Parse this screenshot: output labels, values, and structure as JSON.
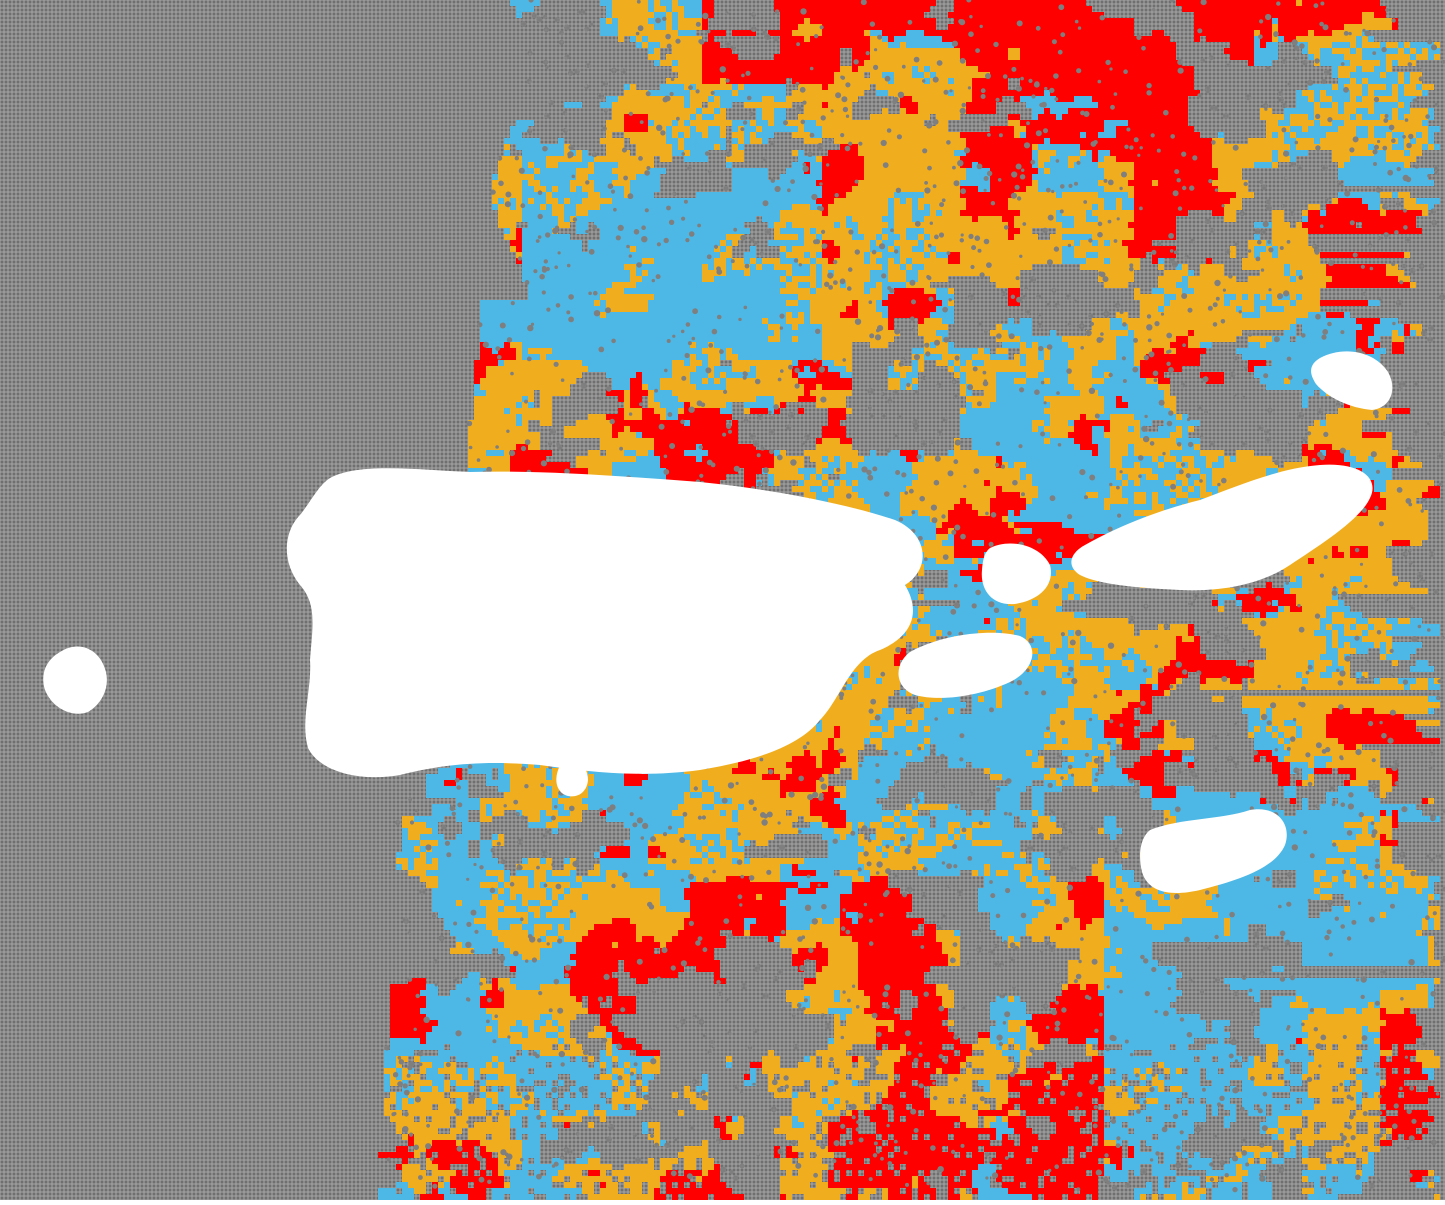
{
  "map": {
    "kind": "gridded classification raster",
    "labels_visible": false,
    "palette": {
      "background": "#ffffff",
      "no_data_cell": "#7f7f7f",
      "class_light_blue": "#4db8e6",
      "class_orange": "#f0ae1e",
      "class_red": "#ff0000",
      "land_mask": "#ffffff"
    },
    "classes": [
      {
        "id": "gray",
        "color": "#7f7f7f"
      },
      {
        "id": "blue",
        "color": "#4db8e6"
      },
      {
        "id": "orange",
        "color": "#f0ae1e"
      },
      {
        "id": "red",
        "color": "#ff0000"
      }
    ],
    "landmasses": [
      {
        "id": "main-island"
      },
      {
        "id": "small-west-island"
      },
      {
        "id": "south-islet"
      },
      {
        "id": "mid-island"
      },
      {
        "id": "small-center-island"
      },
      {
        "id": "east-long-island"
      },
      {
        "id": "northeast-island"
      },
      {
        "id": "southeast-island"
      }
    ]
  }
}
